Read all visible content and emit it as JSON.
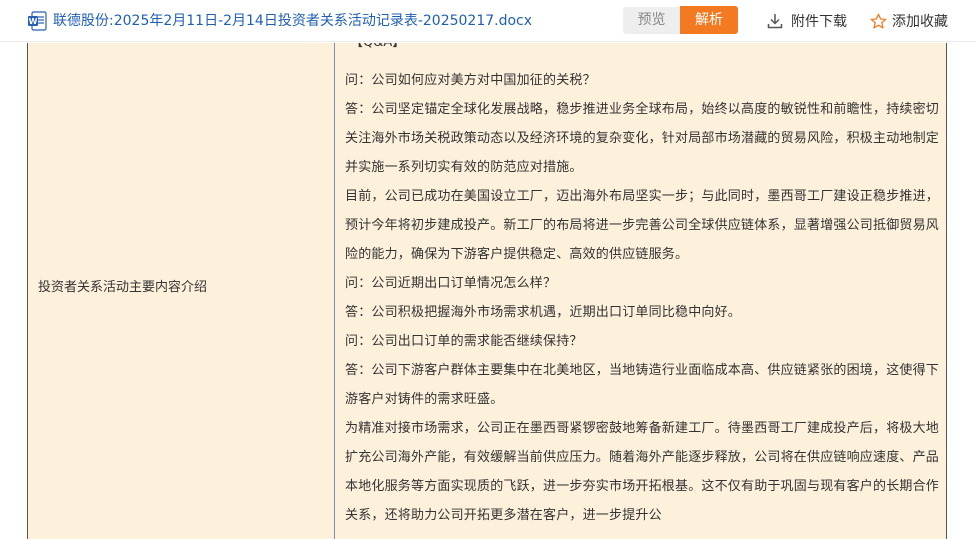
{
  "header": {
    "doc_title": "联德股份:2025年2月11日-2月14日投资者关系活动记录表-20250217.docx",
    "doc_icon": "word-doc-icon",
    "preview_label": "预览",
    "parse_label": "解析",
    "download_label": "附件下载",
    "favorite_label": "添加收藏",
    "accent_color": "#f47a22"
  },
  "table": {
    "left_label": "投资者关系活动主要内容介绍",
    "qa_header": "【Q&A】",
    "paragraphs": [
      "问：公司如何应对美方对中国加征的关税？",
      "答：公司坚定锚定全球化发展战略，稳步推进业务全球布局，始终以高度的敏锐性和前瞻性，持续密切关注海外市场关税政策动态以及经济环境的复杂变化，针对局部市场潜藏的贸易风险，积极主动地制定并实施一系列切实有效的防范应对措施。",
      "目前，公司已成功在美国设立工厂，迈出海外布局坚实一步；与此同时，墨西哥工厂建设正稳步推进，预计今年将初步建成投产。新工厂的布局将进一步完善公司全球供应链体系，显著增强公司抵御贸易风险的能力，确保为下游客户提供稳定、高效的供应链服务。",
      "问：公司近期出口订单情况怎么样？",
      "答：公司积极把握海外市场需求机遇，近期出口订单同比稳中向好。",
      "问：公司出口订单的需求能否继续保持？",
      "答：公司下游客户群体主要集中在北美地区，当地铸造行业面临成本高、供应链紧张的困境，这使得下游客户对铸件的需求旺盛。",
      "为精准对接市场需求，公司正在墨西哥紧锣密鼓地筹备新建工厂。待墨西哥工厂建成投产后，将极大地扩充公司海外产能，有效缓解当前供应压力。随着海外产能逐步释放，公司将在供应链响应速度、产品本地化服务等方面实现质的飞跃，进一步夯实市场开拓根基。这不仅有助于巩固与现有客户的长期合作关系，还将助力公司开拓更多潜在客户，进一步提升公"
    ]
  }
}
